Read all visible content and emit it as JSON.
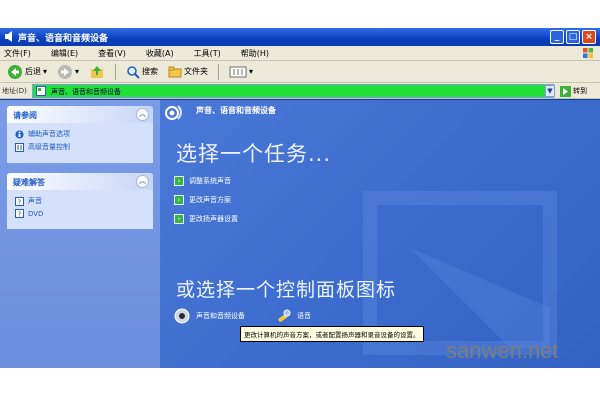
{
  "window": {
    "title": "声音、语音和音频设备"
  },
  "menu": [
    "文件(F)",
    "编辑(E)",
    "查看(V)",
    "收藏(A)",
    "工具(T)",
    "帮助(H)"
  ],
  "toolbar": {
    "back": "后退",
    "search": "搜索",
    "folders": "文件夹"
  },
  "address": {
    "label": "地址(D)",
    "value": "声音、语音和音频设备",
    "go": "转到"
  },
  "left_pane": {
    "see_also": {
      "title": "请参阅",
      "items": [
        "辅助声音选项",
        "高级音量控制"
      ]
    },
    "troubleshoot": {
      "title": "疑难解答",
      "items": [
        "声音",
        "DVD"
      ]
    }
  },
  "main": {
    "header": "声音、语音和音频设备",
    "task_title": "选择一个任务...",
    "tasks": [
      "调整系统声音",
      "更改声音方案",
      "更改扬声器设置"
    ],
    "cp_title": "或选择一个控制面板图标",
    "cp_icons": [
      "声音和音频设备",
      "语音"
    ],
    "tooltip": "更改计算机的声音方案，或者配置扬声器和录音设备的设置。"
  },
  "watermark": "sanwen.net",
  "colors": {
    "title_bar": "#0b3fbf",
    "left_pane": "#7b9de8",
    "main_bg": "#3a6acc",
    "address_field": "#22e03a",
    "task_arrow": "#37b24a"
  }
}
